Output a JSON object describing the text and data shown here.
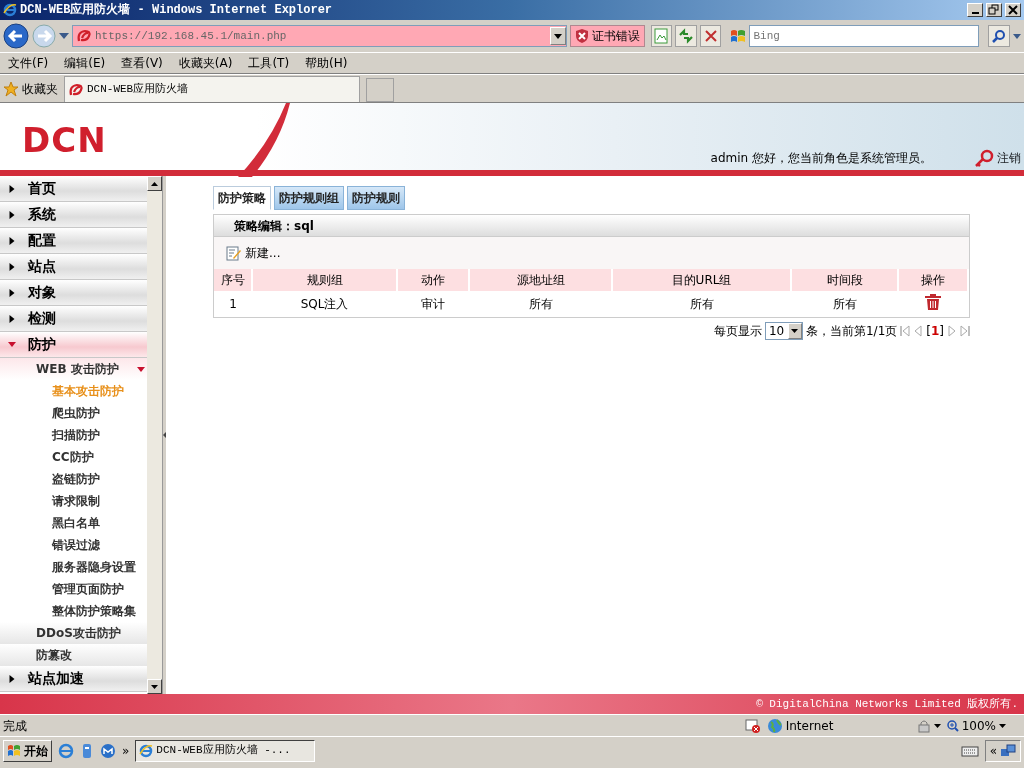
{
  "window": {
    "title": "DCN-WEB应用防火墙 - Windows Internet Explorer"
  },
  "address_bar": {
    "url": "https://192.168.45.1/main.php",
    "cert_error": "证书错误"
  },
  "search": {
    "placeholder": "Bing"
  },
  "menu": [
    "文件(F)",
    "编辑(E)",
    "查看(V)",
    "收藏夹(A)",
    "工具(T)",
    "帮助(H)"
  ],
  "favorites": {
    "label": "收藏夹",
    "tabs": [
      {
        "label": "DCN-WEB应用防火墙",
        "selected": true
      }
    ]
  },
  "header": {
    "logo": "DCN",
    "welcome": "admin 您好，您当前角色是系统管理员。",
    "logout": "注销"
  },
  "sidebar": {
    "items": [
      {
        "label": "首页",
        "expanded": false
      },
      {
        "label": "系统",
        "expanded": false
      },
      {
        "label": "配置",
        "expanded": false
      },
      {
        "label": "站点",
        "expanded": false
      },
      {
        "label": "对象",
        "expanded": false
      },
      {
        "label": "检测",
        "expanded": false
      },
      {
        "label": "防护",
        "expanded": true,
        "children": [
          {
            "label": "WEB 攻击防护",
            "expanded": true,
            "children": [
              {
                "label": "基本攻击防护",
                "selected": true
              },
              {
                "label": "爬虫防护",
                "selected": false
              },
              {
                "label": "扫描防护",
                "selected": false
              },
              {
                "label": "CC防护",
                "selected": false
              },
              {
                "label": "盗链防护",
                "selected": false
              },
              {
                "label": "请求限制",
                "selected": false
              },
              {
                "label": "黑白名单",
                "selected": false
              },
              {
                "label": "错误过滤",
                "selected": false
              },
              {
                "label": "服务器隐身设置",
                "selected": false
              },
              {
                "label": "管理页面防护",
                "selected": false
              },
              {
                "label": "整体防护策略集",
                "selected": false
              }
            ]
          },
          {
            "label": "DDoS攻击防护"
          },
          {
            "label": "防篡改"
          }
        ]
      },
      {
        "label": "站点加速",
        "expanded": false
      }
    ]
  },
  "tabs": [
    {
      "label": "防护策略",
      "selected": true
    },
    {
      "label": "防护规则组",
      "selected": false
    },
    {
      "label": "防护规则",
      "selected": false
    }
  ],
  "panel": {
    "title": "策略编辑：sql",
    "new_button": "新建...",
    "table": {
      "columns": [
        "序号",
        "规则组",
        "动作",
        "源地址组",
        "目的URL组",
        "时间段",
        "操作"
      ],
      "rows": [
        [
          "1",
          "SQL注入",
          "审计",
          "所有",
          "所有",
          "所有"
        ]
      ]
    }
  },
  "pagination": {
    "per_page_label": "每页显示",
    "per_page": "10",
    "summary": "条，当前第1/1页",
    "current_page": "[**1**]"
  },
  "footer": {
    "copyright": "© DigitalChina Networks Limited 版权所有."
  },
  "status_bar": {
    "text": "完成",
    "zone": "Internet",
    "zoom": "100%"
  },
  "taskbar": {
    "start": "开始",
    "more": "»",
    "windows": [
      {
        "label": "DCN-WEB应用防火墙 -...",
        "selected": true
      }
    ],
    "tray_more": "«"
  }
}
